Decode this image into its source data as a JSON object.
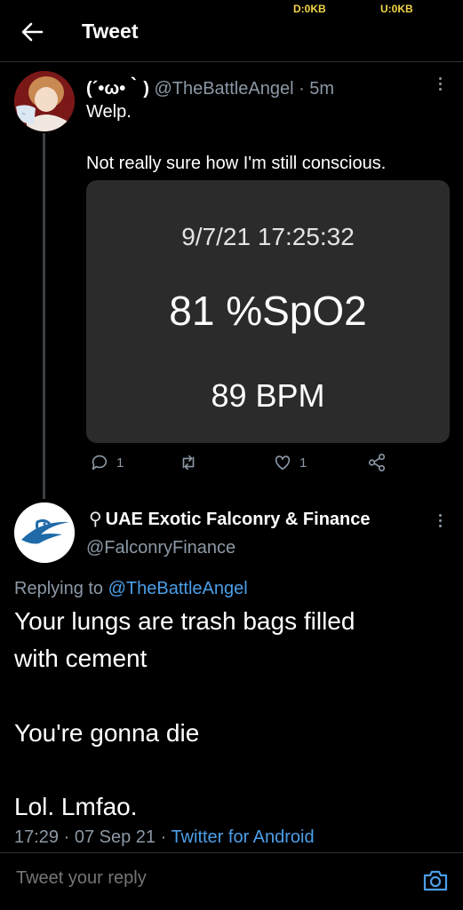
{
  "status_bar": {
    "download": "D:0KB",
    "upload": "U:0KB"
  },
  "header": {
    "title": "Tweet"
  },
  "tweet1": {
    "display_name": "(´•ω•｀)",
    "handle": "@TheBattleAngel",
    "time": "· 5m",
    "text_line1": "Welp.",
    "text_line2": "Not really sure how I'm still conscious.",
    "media": {
      "datetime": "9/7/21 17:25:32",
      "spo2": "81 %SpO2",
      "bpm": "89 BPM"
    },
    "reply_count": "1",
    "like_count": "1"
  },
  "tweet2": {
    "display_name": "UAE Exotic Falconry & Finance",
    "handle": "@FalconryFinance",
    "replying_prefix": "Replying to",
    "replying_to": "@TheBattleAngel",
    "body": [
      "Your lungs are trash bags filled",
      "with cement",
      "You're gonna die",
      "Lol. Lmfao."
    ],
    "meta_time": "17:29 · 07 Sep 21 ·",
    "meta_source": "Twitter for Android"
  },
  "reply_bar": {
    "placeholder": "Tweet your reply"
  },
  "colors": {
    "link": "#4c9ee8",
    "muted": "#8b98a5",
    "background": "#000000",
    "media_bg": "#2b2b2b",
    "status": "#f2d34a"
  },
  "icons": [
    "back-arrow-icon",
    "more-icon",
    "reply-icon",
    "retweet-icon",
    "like-icon",
    "share-icon",
    "bird-icon",
    "camera-icon"
  ]
}
